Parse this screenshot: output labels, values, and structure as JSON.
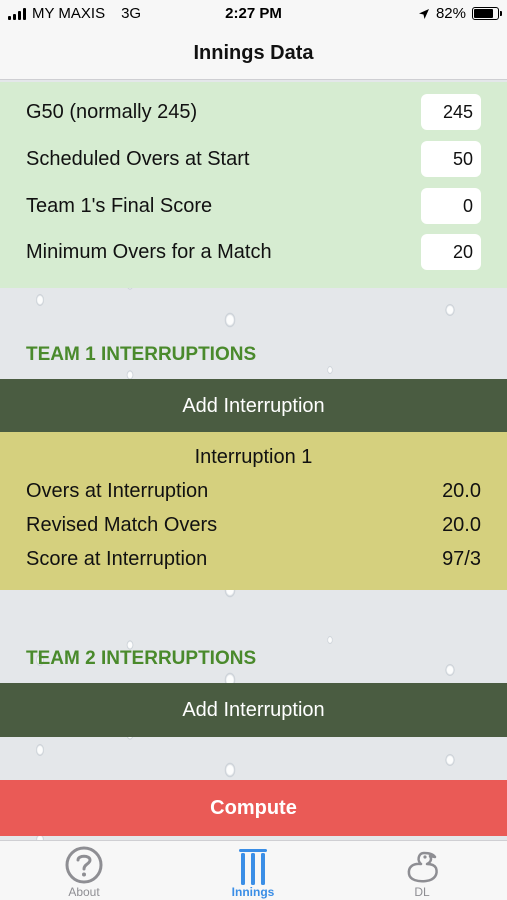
{
  "status_bar": {
    "carrier": "MY MAXIS",
    "network": "3G",
    "time": "2:27 PM",
    "battery": "82%",
    "battery_level": 0.82
  },
  "nav": {
    "title": "Innings Data"
  },
  "settings": [
    {
      "label": "G50 (normally 245)",
      "value": "245"
    },
    {
      "label": "Scheduled Overs at Start",
      "value": "50"
    },
    {
      "label": "Team 1's Final Score",
      "value": "0"
    },
    {
      "label": "Minimum Overs for a Match",
      "value": "20"
    }
  ],
  "team1": {
    "title": "TEAM 1 INTERRUPTIONS",
    "add_label": "Add Interruption",
    "interruption": {
      "title": "Interruption 1",
      "rows": [
        {
          "label": "Overs at Interruption",
          "value": "20.0"
        },
        {
          "label": "Revised Match Overs",
          "value": "20.0"
        },
        {
          "label": "Score at Interruption",
          "value": "97/3"
        }
      ]
    }
  },
  "team2": {
    "title": "TEAM 2 INTERRUPTIONS",
    "add_label": "Add Interruption"
  },
  "compute_label": "Compute",
  "tabs": [
    {
      "label": "About",
      "icon": "question-circle-icon"
    },
    {
      "label": "Innings",
      "icon": "stumps-icon",
      "active": true
    },
    {
      "label": "DL",
      "icon": "duck-icon"
    }
  ],
  "colors": {
    "accent": "#3a8ee6",
    "section_title": "#4a8a2c",
    "add_button": "#4a5c41",
    "interruption_bg": "#d5d07e",
    "settings_bg": "#d6ecd1",
    "compute": "#ea5a56"
  }
}
